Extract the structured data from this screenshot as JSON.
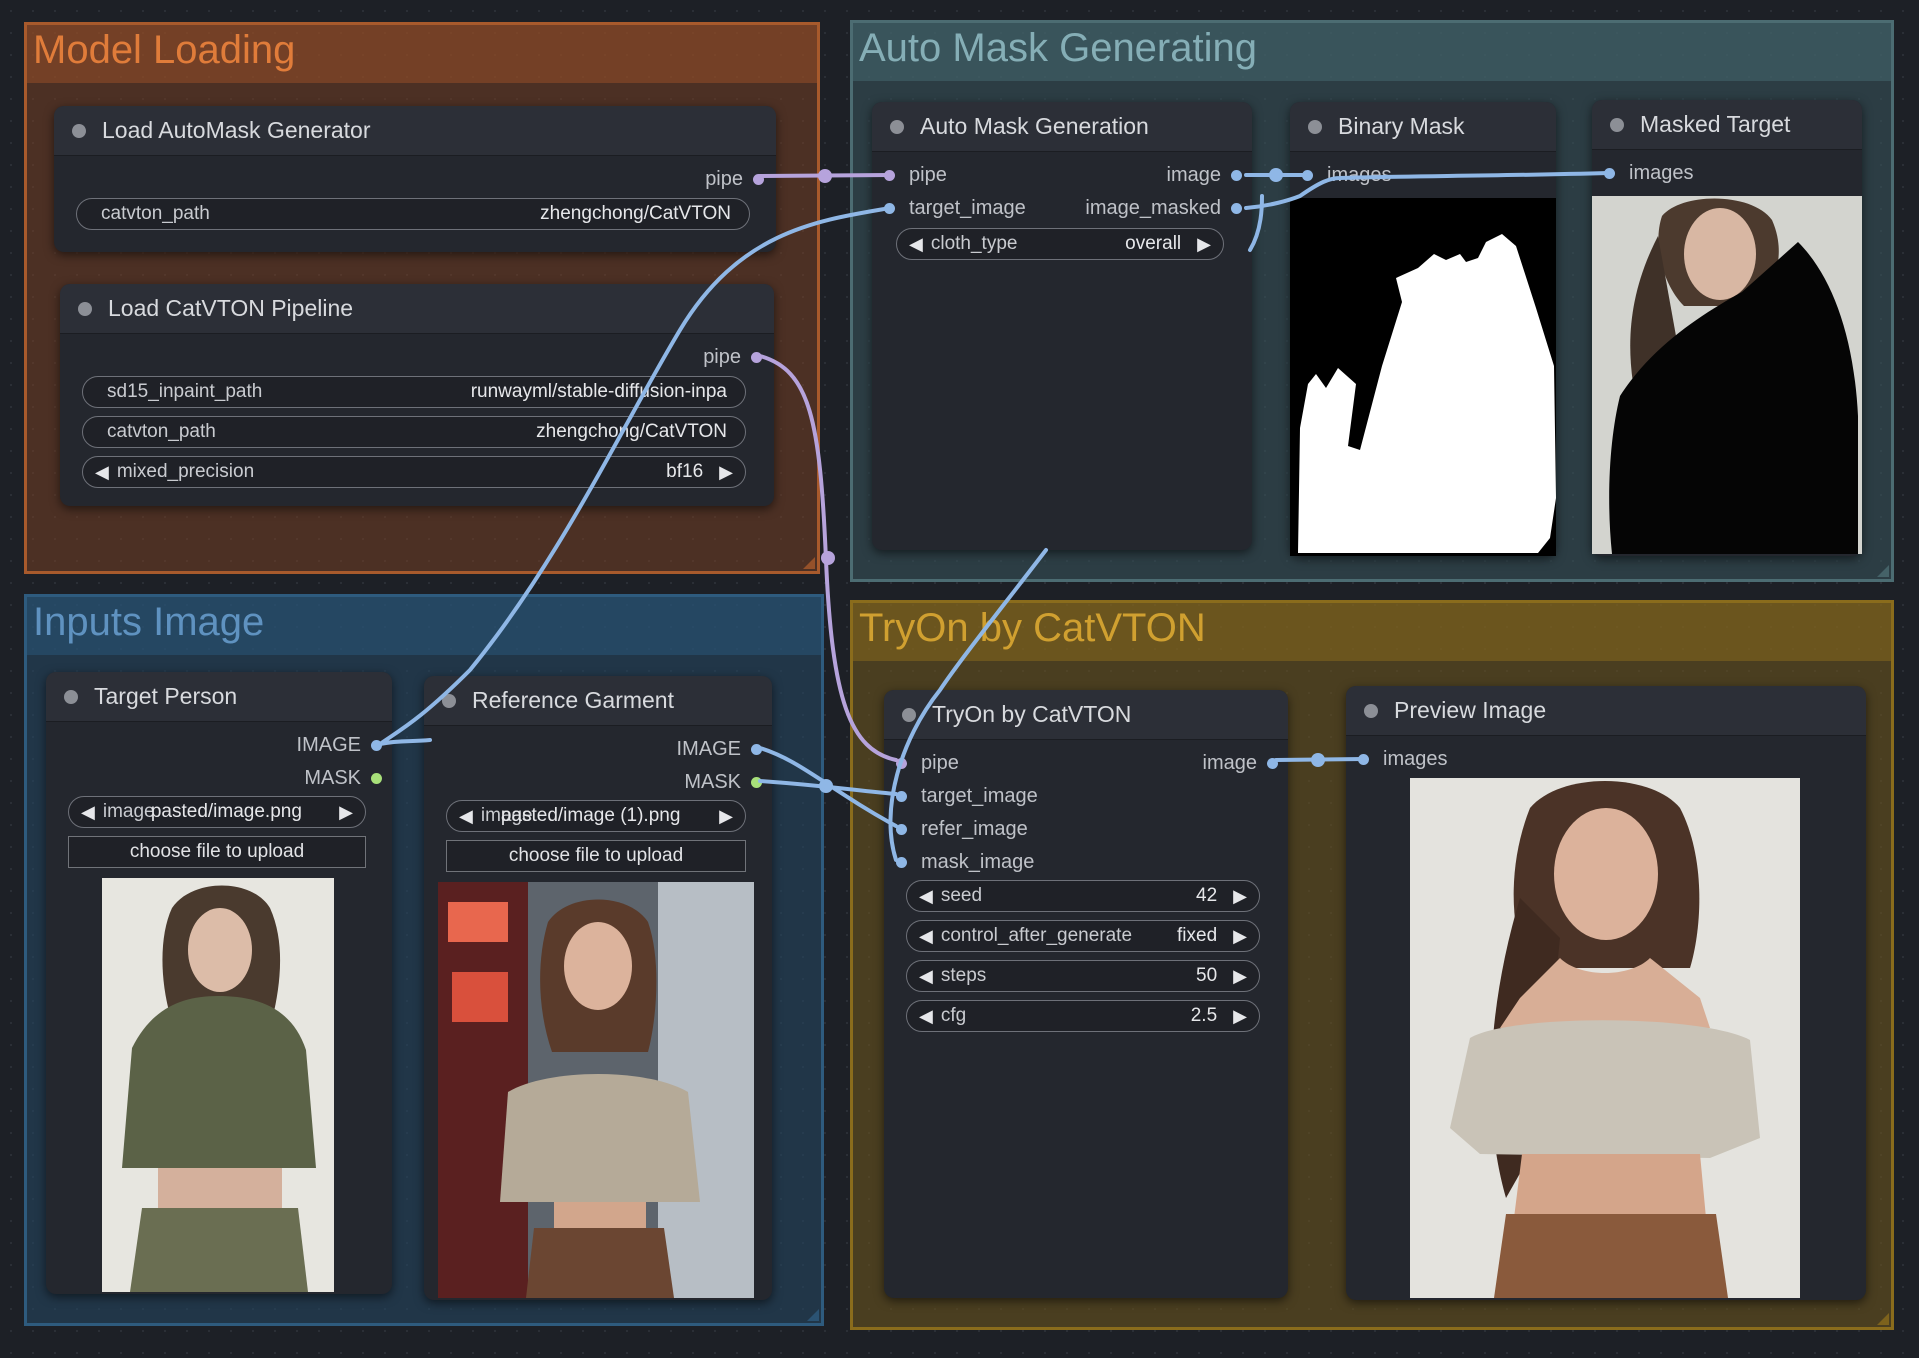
{
  "groups": {
    "model_loading": "Model Loading",
    "auto_mask": "Auto Mask Generating",
    "inputs_image": "Inputs Image",
    "tryon": "TryOn by CatVTON"
  },
  "nodes": {
    "automask_loader": {
      "title": "Load AutoMask Generator",
      "out_pipe": "pipe",
      "catvton_path": {
        "label": "catvton_path",
        "value": "zhengchong/CatVTON"
      }
    },
    "catvton_loader": {
      "title": "Load CatVTON Pipeline",
      "out_pipe": "pipe",
      "sd15_inpaint_path": {
        "label": "sd15_inpaint_path",
        "value": "runwayml/stable-diffusion-inpa"
      },
      "catvton_path": {
        "label": "catvton_path",
        "value": "zhengchong/CatVTON"
      },
      "mixed_precision": {
        "label": "mixed_precision",
        "value": "bf16"
      }
    },
    "auto_mask_generation": {
      "title": "Auto Mask Generation",
      "in_pipe": "pipe",
      "in_target_image": "target_image",
      "out_image": "image",
      "out_image_masked": "image_masked",
      "cloth_type": {
        "label": "cloth_type",
        "value": "overall"
      }
    },
    "binary_mask": {
      "title": "Binary Mask",
      "in_images": "images"
    },
    "masked_target": {
      "title": "Masked Target",
      "in_images": "images"
    },
    "target_person": {
      "title": "Target Person",
      "out_image": "IMAGE",
      "out_mask": "MASK",
      "image_label": "image",
      "image_value": "pasted/image.png",
      "upload": "choose file to upload"
    },
    "reference_garment": {
      "title": "Reference Garment",
      "out_image": "IMAGE",
      "out_mask": "MASK",
      "image_label": "image",
      "image_value": "pasted/image (1).png",
      "upload": "choose file to upload"
    },
    "tryon": {
      "title": "TryOn by CatVTON",
      "in_pipe": "pipe",
      "in_target_image": "target_image",
      "in_refer_image": "refer_image",
      "in_mask_image": "mask_image",
      "out_image": "image",
      "seed": {
        "label": "seed",
        "value": "42"
      },
      "control_after_generate": {
        "label": "control_after_generate",
        "value": "fixed"
      },
      "steps": {
        "label": "steps",
        "value": "50"
      },
      "cfg": {
        "label": "cfg",
        "value": "2.5"
      }
    },
    "preview_image": {
      "title": "Preview Image",
      "in_images": "images"
    }
  },
  "colors": {
    "pipe_wire": "#b6a3dc",
    "image_wire": "#8fb7e6",
    "mask_wire": "#a8e07a",
    "model_group": "#a85a2c",
    "auto_group": "#4c6c72",
    "inputs_group": "#2e5b7e",
    "tryon_group": "#8a6c1c"
  }
}
